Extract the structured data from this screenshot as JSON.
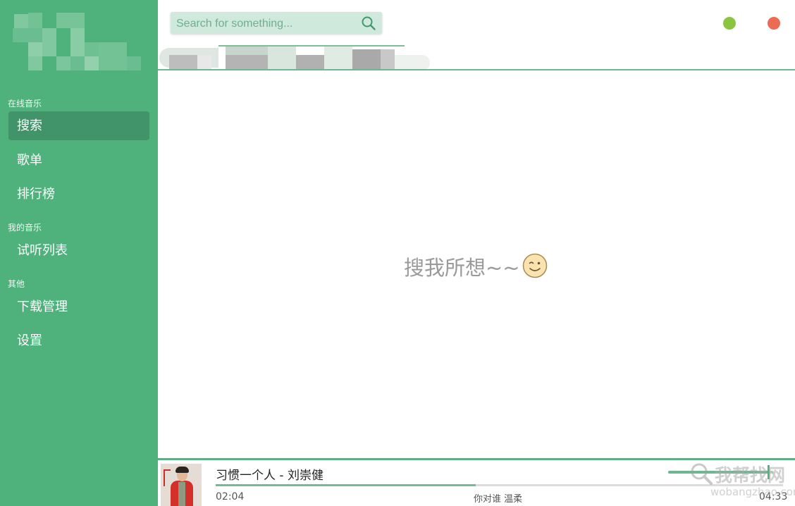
{
  "sidebar": {
    "sections": [
      {
        "title": "在线音乐",
        "items": [
          {
            "label": "搜索",
            "active": true
          },
          {
            "label": "歌单",
            "active": false
          },
          {
            "label": "排行榜",
            "active": false
          }
        ]
      },
      {
        "title": "我的音乐",
        "items": [
          {
            "label": "试听列表",
            "active": false
          }
        ]
      },
      {
        "title": "其他",
        "items": [
          {
            "label": "下载管理",
            "active": false
          },
          {
            "label": "设置",
            "active": false
          }
        ]
      }
    ]
  },
  "header": {
    "search_placeholder": "Search for something...",
    "search_icon": "search-icon",
    "minimize_color": "#8bc53f",
    "close_color": "#ec6c53"
  },
  "main": {
    "empty_text": "搜我所想~~",
    "empty_icon": "wink-emoji-icon"
  },
  "player": {
    "song": "习惯一个人 - 刘崇健",
    "current_time": "02:04",
    "total_time": "04:33",
    "progress": 0.458,
    "volume": 0.95,
    "lyric": "你对谁 温柔"
  },
  "watermark": {
    "text": "我帮找网",
    "url": "wobangzhao.com"
  },
  "colors": {
    "accent": "#4fb17b",
    "active_item": "#41946a",
    "search_bg": "#cfe9dc"
  }
}
